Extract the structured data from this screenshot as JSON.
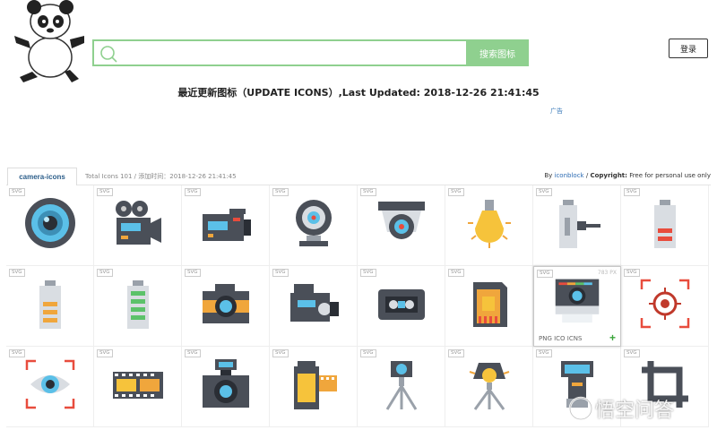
{
  "header": {
    "search_placeholder": "",
    "search_button_label": "搜索图标",
    "login_label": "登录"
  },
  "headline": {
    "text": "最近更新图标（UPDATE ICONS）,Last Updated: 2018-12-26 21:41:45",
    "ad_label": "广告"
  },
  "toolbar": {
    "tab_label": "camera-icons",
    "total_text": "Total Icons 101 / 添加时间：2018-12-26 21:41:45",
    "credits_by": "By",
    "credits_author": "iconblock",
    "credits_separator": "/",
    "credits_copyright_label": "Copyright:",
    "credits_copyright_text": "Free for personal use only"
  },
  "grid": {
    "badge_label": "SVG",
    "hover_size": "783 PX",
    "hover_formats": "PNG  ICO  ICNS",
    "hover_add": "+",
    "icons": [
      "lens-icon",
      "film-camera-icon",
      "video-camera-icon",
      "webcam-icon",
      "security-camera-icon",
      "light-bulb-icon",
      "battery-charger-icon",
      "battery-low-icon",
      "battery-half-icon",
      "battery-full-icon",
      "photo-camera-icon",
      "camcorder-icon",
      "cassette-icon",
      "memory-card-icon",
      "instant-camera-icon",
      "focus-target-icon",
      "eye-focus-icon",
      "film-strip-icon",
      "camera-flash-icon",
      "film-roll-icon",
      "tripod-camera-icon",
      "studio-light-icon",
      "flash-unit-icon",
      "crop-icon"
    ]
  },
  "watermark": {
    "text": "悟空问答"
  },
  "colors": {
    "accent_green": "#8fd08f",
    "link_blue": "#2c6bb3",
    "icon_blue": "#5bc0e8",
    "icon_dark": "#4a4f58"
  }
}
